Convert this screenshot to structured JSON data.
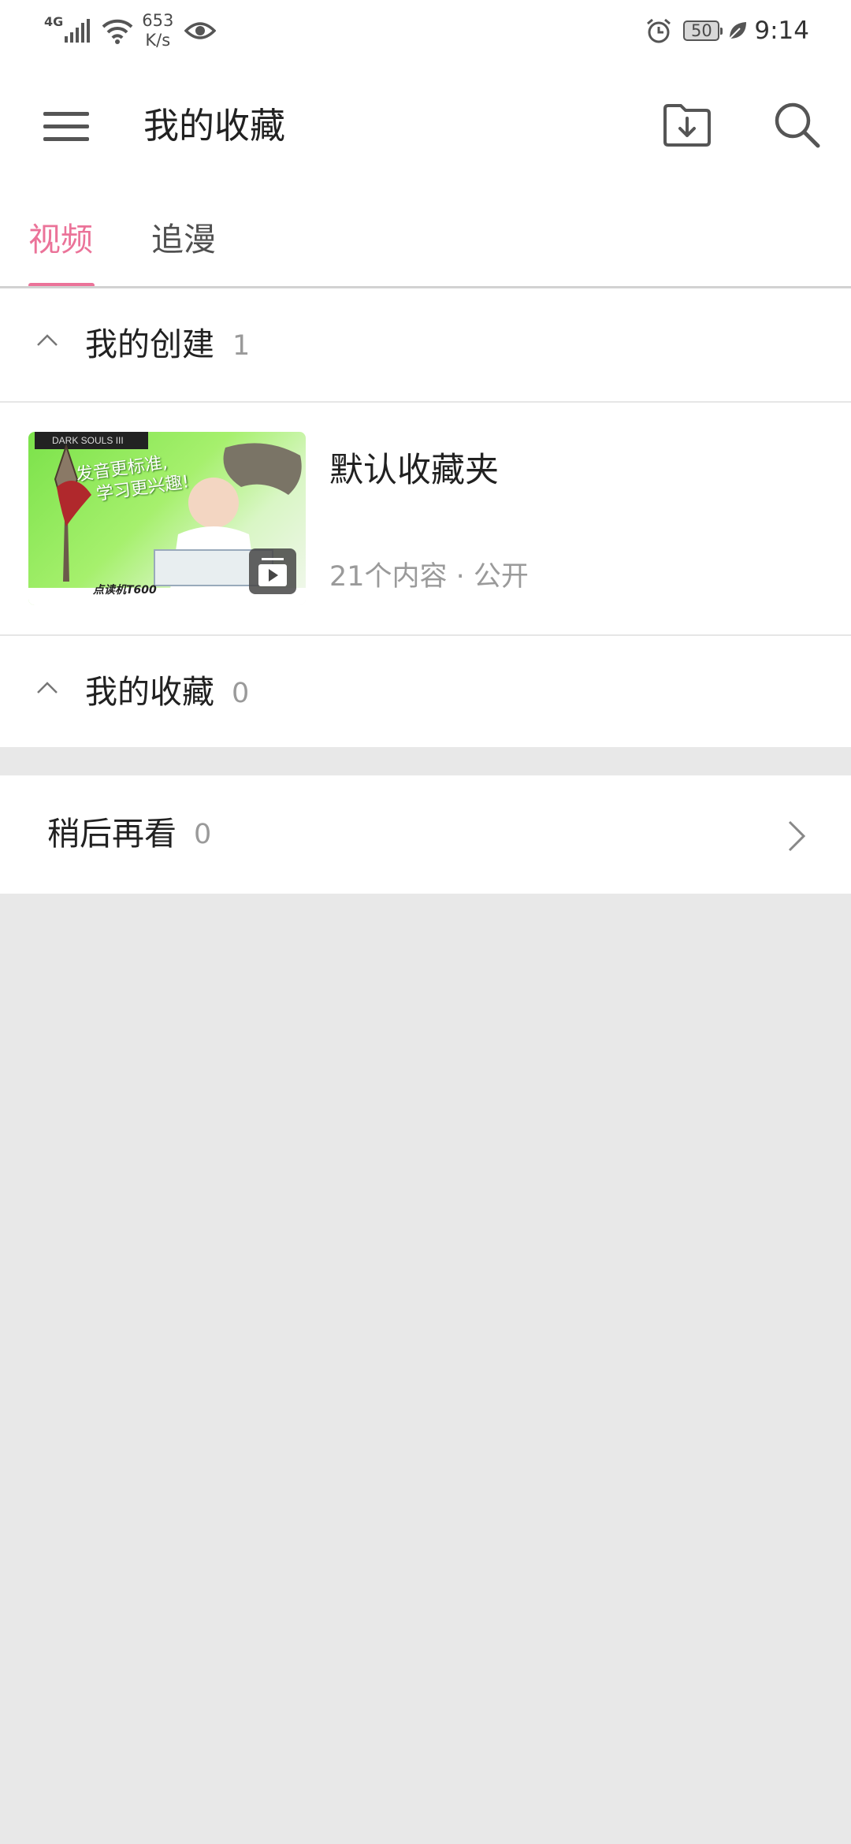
{
  "status_bar": {
    "network": "4G",
    "speed_value": "653",
    "speed_unit": "K/s",
    "battery": "50",
    "time": "9:14"
  },
  "app_bar": {
    "title": "我的收藏"
  },
  "tabs": [
    {
      "label": "视频",
      "active": true
    },
    {
      "label": "追漫",
      "active": false
    }
  ],
  "sections": {
    "created": {
      "title": "我的创建",
      "count": "1"
    },
    "collected": {
      "title": "我的收藏",
      "count": "0"
    }
  },
  "folders": [
    {
      "name": "默认收藏夹",
      "meta": "21个内容 · 公开",
      "thumbnail": {
        "game_tag": "DARK SOULS III",
        "slogan_line1": "发音更标准,",
        "slogan_line2": "学习更兴趣!",
        "product_label": "点读机T600"
      }
    }
  ],
  "watch_later": {
    "title": "稍后再看",
    "count": "0"
  },
  "colors": {
    "accent": "#eb7399",
    "background": "#e8e8e8",
    "text_primary": "#212121",
    "text_secondary": "#9a9a9a"
  },
  "icons": [
    "menu-icon",
    "folder-download-icon",
    "search-icon",
    "caret-up-icon",
    "play-icon",
    "chevron-right-icon"
  ]
}
